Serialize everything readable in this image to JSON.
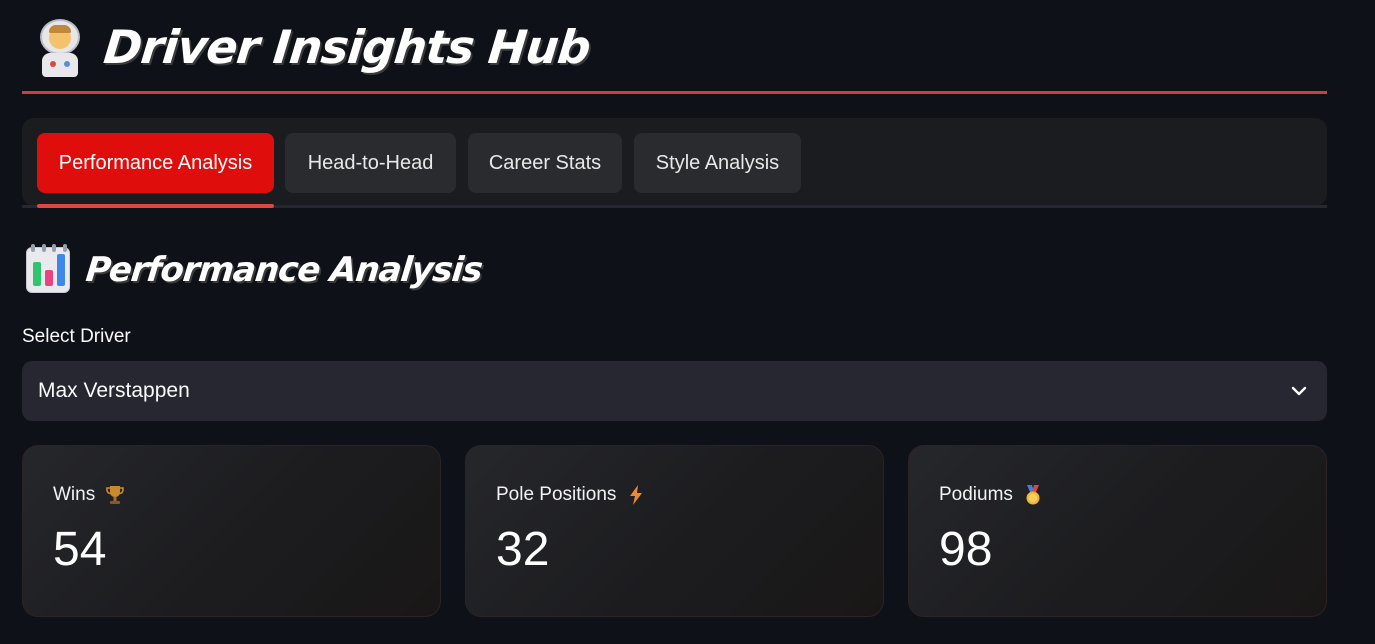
{
  "header": {
    "title": "Driver Insights Hub",
    "icon": "astronaut-icon",
    "accent_color": "#c8423c"
  },
  "tabs": [
    {
      "label": "Performance Analysis",
      "active": true
    },
    {
      "label": "Head-to-Head",
      "active": false
    },
    {
      "label": "Career Stats",
      "active": false
    },
    {
      "label": "Style Analysis",
      "active": false
    }
  ],
  "tab_active_color": "#e00d0d",
  "section": {
    "title": "Performance Analysis",
    "icon": "bar-chart-icon"
  },
  "driver_select": {
    "label": "Select Driver",
    "value": "Max Verstappen",
    "icon": "chevron-down-icon"
  },
  "stats": [
    {
      "label": "Wins",
      "icon": "trophy-icon",
      "value": "54"
    },
    {
      "label": "Pole Positions",
      "icon": "lightning-icon",
      "value": "32"
    },
    {
      "label": "Podiums",
      "icon": "medal-icon",
      "value": "98"
    }
  ],
  "colors": {
    "background": "#0e1117",
    "surface": "#262730"
  }
}
